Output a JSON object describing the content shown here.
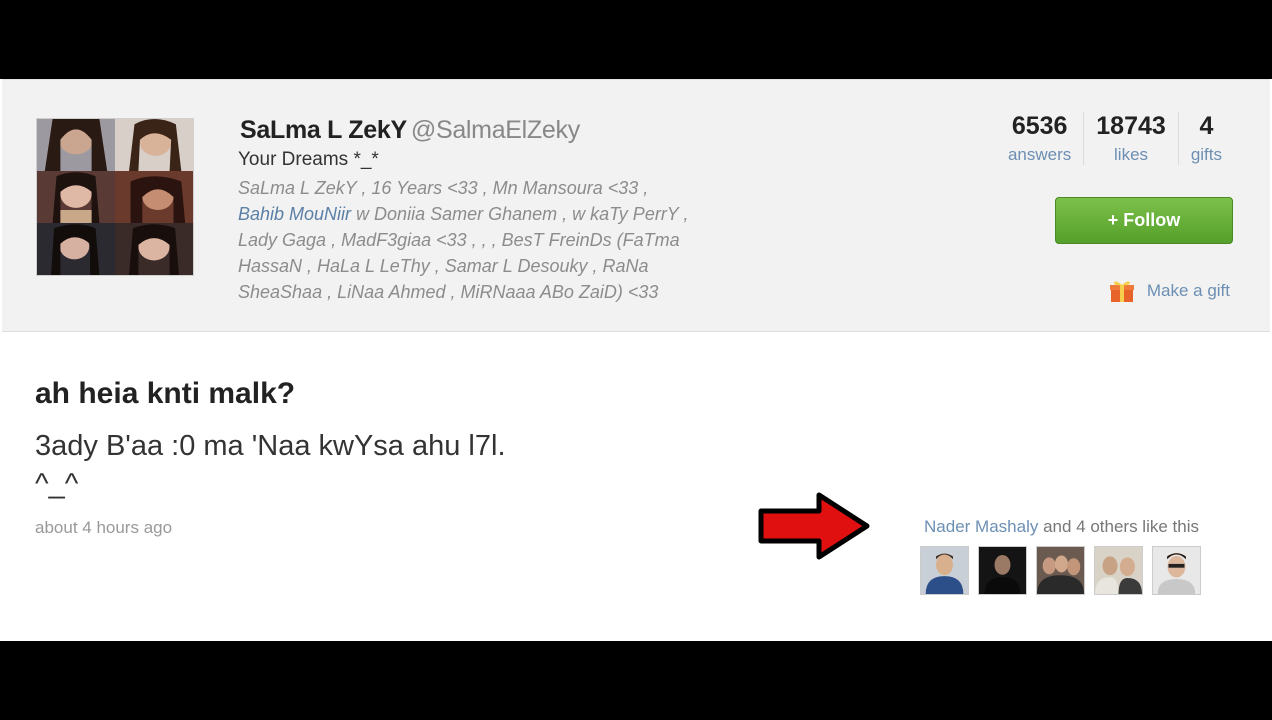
{
  "profile": {
    "display_name": "SaLma L ZekY",
    "handle": "@SalmaElZeky",
    "status": "Your Dreams *_*",
    "bio": {
      "line1": "SaLma L ZekY , 16 Years <33 , Mn Mansoura <33 ,",
      "line2_link": "Bahib MouNiir",
      "line2_rest": " w Doniia Samer Ghanem , w kaTy PerrY ,",
      "line3": "Lady Gaga , MadF3giaa <33 , , , BesT FreinDs (FaTma",
      "line4": "HassaN , HaLa L LeThy , Samar L Desouky , RaNa",
      "line5": "SheaShaa , LiNaa Ahmed , MiRNaaa ABo ZaiD) <33"
    }
  },
  "stats": {
    "answers": {
      "value": "6536",
      "label": "answers"
    },
    "likes": {
      "value": "18743",
      "label": "likes"
    },
    "gifts": {
      "value": "4",
      "label": "gifts"
    }
  },
  "actions": {
    "follow_label": "+ Follow",
    "gift_label": "Make a gift",
    "gift_icon": "gift-icon"
  },
  "post": {
    "question": "ah heia knti malk?",
    "answer": "3ady B'aa :0 ma 'Naa kwYsa ahu l7l.\n^_^",
    "timestamp": "about 4 hours ago",
    "likes": {
      "liker": "Nader Mashaly",
      "rest": " and 4 others like this"
    }
  },
  "colors": {
    "link": "#6c8fb3",
    "follow_button": "#5fa832",
    "annotation_arrow": "#e01010"
  }
}
